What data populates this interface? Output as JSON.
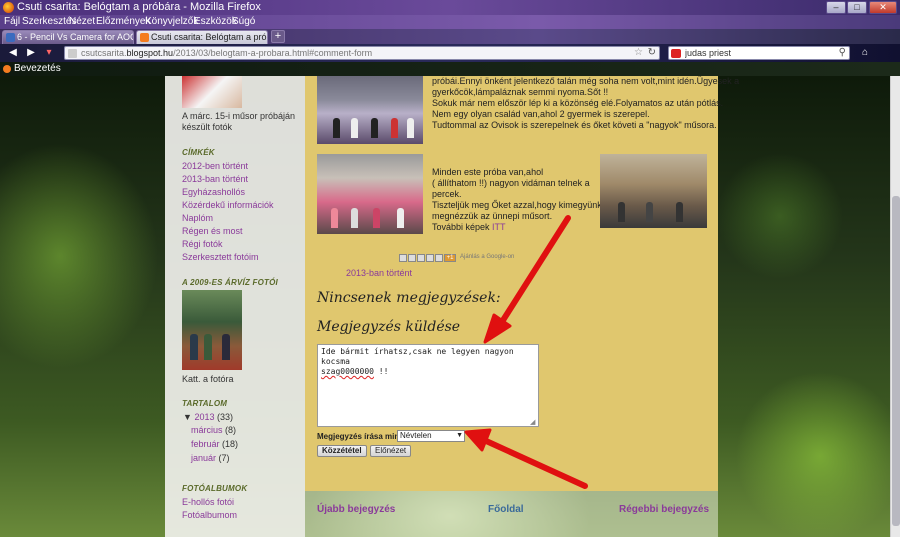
{
  "window": {
    "title": "Csuti csarita: Belógtam a próbára - Mozilla Firefox",
    "minimize": "–",
    "maximize": "□",
    "close": "✕"
  },
  "menu": [
    "Fájl",
    "Szerkesztés",
    "Nézet",
    "Előzmények",
    "Könyvjelzők",
    "Eszközök",
    "Súgó"
  ],
  "tabs": [
    {
      "label": "6 - Pencil Vs Camera for AOC ...",
      "active": false
    },
    {
      "label": "Csuti csarita: Belógtam a pró...",
      "active": true
    }
  ],
  "newtab": "+",
  "nav": {
    "back": "◀",
    "forward": "▶",
    "history": "▾",
    "url_prefix": "csutcsarita.",
    "url_domain": "blogspot.hu",
    "url_path": "/2013/03/belogtam-a-probara.html#comment-form",
    "search_value": "judas priest",
    "home": "⌂"
  },
  "bookmarks": {
    "item": "Bevezetés"
  },
  "sidebar": {
    "photo1_caption_1": "A márc. 15-i műsor próbáján",
    "photo1_caption_2": "készült fotók",
    "labels_heading": "CÍMKÉK",
    "labels": [
      "2012-ben történt",
      "2013-ban történt",
      "Egyházashollós",
      "Közérdekű információk",
      "Naplóm",
      "Régen és most",
      "Régi fotók",
      "Szerkesztett fotóim"
    ],
    "photos_heading": "A 2009-ES ÁRVÍZ FOTÓI",
    "photo2_caption": "Katt. a fotóra",
    "archive_heading": "TARTALOM",
    "archive_year": "2013",
    "archive_year_count": "(33)",
    "archive_months": [
      {
        "name": "március",
        "count": "(8)"
      },
      {
        "name": "február",
        "count": "(18)"
      },
      {
        "name": "január",
        "count": "(7)"
      }
    ],
    "albums_heading": "FOTÓALBUMOK",
    "albums": [
      "E-hollós fotói",
      "Fotóalbumom"
    ]
  },
  "post": {
    "para1": [
      "próbái.Ennyi önként jelentkező talán még soha nem volt,mint idén.Ügyesek a",
      "gyerkőcök,lámpaláznak semmi nyoma.Sőt !!",
      "Sokuk már nem először lép ki a közönség elé.Folyamatos az után pótlás.",
      "Nem egy olyan család van,ahol 2 gyermek is szerepel.",
      "Tudtommal az Ovisok is szerepelnek és őket követi a \"nagyok\" műsora."
    ],
    "para2": [
      "Minden este próba van,ahol",
      "( állíthatom !!) nagyon vidáman telnek a",
      "percek.",
      "Tiszteljük meg Őket azzal,hogy kimegyünk és",
      "megnézzük az ünnepi  műsort."
    ],
    "more_prefix": "További képek ",
    "more_link": "ITT",
    "share_plus": "+1",
    "share_note": "Ajánlás a Google-on",
    "label_link": "2013-ban történt"
  },
  "comments": {
    "none_heading": "Nincsenek megjegyzések:",
    "send_heading": "Megjegyzés küldése",
    "body_line1": "Ide bármit írhatsz,csak ne legyen nagyon kocsma",
    "body_squig": "szag0000000",
    "body_tail": " !!",
    "as_label": "Megjegyzés írása mint:",
    "as_value": "Névtelen",
    "publish": "Közzététel",
    "preview": "Előnézet"
  },
  "pager": {
    "newer": "Újabb bejegyzés",
    "home": "Főoldal",
    "older": "Régebbi bejegyzés"
  },
  "colors": {
    "arrow": "#e01010",
    "link": "#8a3a9a",
    "post_bg": "#e0c76e"
  }
}
